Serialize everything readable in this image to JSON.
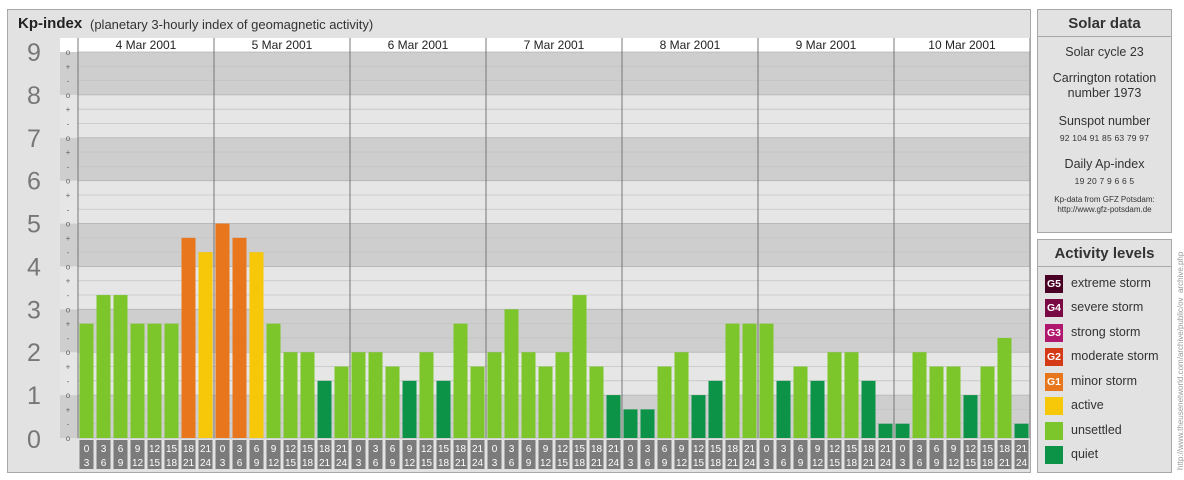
{
  "header": {
    "title": "Kp-index",
    "subtitle": "(planetary 3-hourly index of geomagnetic activity)"
  },
  "chart_data": {
    "type": "bar",
    "title": "Kp-index",
    "subtitle": "(planetary 3-hourly index of geomagnetic activity)",
    "y_ticks": [
      "0",
      "1",
      "2",
      "3",
      "4",
      "5",
      "6",
      "7",
      "8",
      "9"
    ],
    "y_minor_labels": [
      "+",
      "o",
      "-"
    ],
    "ylim": [
      0,
      9
    ],
    "grid": true,
    "days": [
      "4 Mar 2001",
      "5 Mar 2001",
      "6 Mar 2001",
      "7 Mar 2001",
      "8 Mar 2001",
      "9 Mar 2001",
      "10 Mar 2001"
    ],
    "intervals": [
      [
        "0",
        "3"
      ],
      [
        "3",
        "6"
      ],
      [
        "6",
        "9"
      ],
      [
        "9",
        "12"
      ],
      [
        "12",
        "15"
      ],
      [
        "15",
        "18"
      ],
      [
        "18",
        "21"
      ],
      [
        "21",
        "24"
      ]
    ],
    "values": [
      [
        2.667,
        3.333,
        3.333,
        2.667,
        2.667,
        2.667,
        4.667,
        4.333
      ],
      [
        5.0,
        4.667,
        4.333,
        2.667,
        2.0,
        2.0,
        1.333,
        1.667
      ],
      [
        2.0,
        2.0,
        1.667,
        1.333,
        2.0,
        1.333,
        2.667,
        1.667
      ],
      [
        2.0,
        3.0,
        2.0,
        1.667,
        2.0,
        3.333,
        1.667,
        1.0
      ],
      [
        0.667,
        0.667,
        1.667,
        2.0,
        1.0,
        1.333,
        2.667,
        2.667
      ],
      [
        2.667,
        1.333,
        1.667,
        1.333,
        2.0,
        2.0,
        1.333,
        0.333
      ],
      [
        0.333,
        2.0,
        1.667,
        1.667,
        1.0,
        1.667,
        2.333,
        0.333
      ]
    ]
  },
  "solar": {
    "title": "Solar data",
    "cycle": "Solar cycle 23",
    "carrington_1": "Carrington rotation",
    "carrington_2": "number 1973",
    "sunspot_title": "Sunspot number",
    "sunspot_values": "92 104 91 85 63 79 97",
    "ap_title": "Daily Ap-index",
    "ap_values": "19 20 7 9 6 6 5",
    "source_1": "Kp-data from GFZ Potsdam:",
    "source_2": "http://www.gfz-potsdam.de"
  },
  "legend": {
    "title": "Activity levels",
    "items": [
      {
        "code": "G5",
        "label": "extreme storm",
        "color": "#4a0024"
      },
      {
        "code": "G4",
        "label": "severe storm",
        "color": "#7a0a44"
      },
      {
        "code": "G3",
        "label": "strong storm",
        "color": "#b0186e"
      },
      {
        "code": "G2",
        "label": "moderate storm",
        "color": "#d43a16"
      },
      {
        "code": "G1",
        "label": "minor storm",
        "color": "#e8761c"
      },
      {
        "code": "",
        "label": "active",
        "color": "#f7c70a"
      },
      {
        "code": "",
        "label": "unsettled",
        "color": "#7cc52b"
      },
      {
        "code": "",
        "label": "quiet",
        "color": "#0c9348"
      }
    ]
  },
  "colors": {
    "quiet": "#0c9348",
    "unsettled": "#7cc52b",
    "active": "#f7c70a",
    "minor_storm": "#e8761c",
    "moderate_storm": "#d43a16"
  },
  "watermark": "http://www.theusenetworld.com/archive/public/ov_archive.php"
}
